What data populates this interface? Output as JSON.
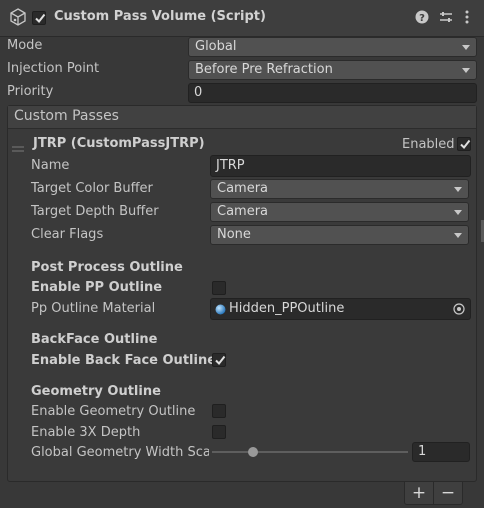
{
  "header": {
    "title": "Custom Pass Volume (Script)",
    "enabled": true
  },
  "fields": {
    "mode_label": "Mode",
    "mode_value": "Global",
    "injection_label": "Injection Point",
    "injection_value": "Before Pre Refraction",
    "priority_label": "Priority",
    "priority_value": "0"
  },
  "custom_passes": {
    "title": "Custom Passes",
    "pass": {
      "title": "JTRP (CustomPassJTRP)",
      "enabled_label": "Enabled",
      "enabled": true,
      "name_label": "Name",
      "name_value": "JTRP",
      "target_color_label": "Target Color Buffer",
      "target_color_value": "Camera",
      "target_depth_label": "Target Depth Buffer",
      "target_depth_value": "Camera",
      "clear_flags_label": "Clear Flags",
      "clear_flags_value": "None"
    },
    "post_process": {
      "header": "Post Process Outline",
      "enable_label": "Enable PP Outline",
      "enable_checked": false,
      "material_label": "Pp Outline Material",
      "material_value": "Hidden_PPOutline"
    },
    "backface": {
      "header": "BackFace Outline",
      "enable_label": "Enable Back Face Outline",
      "enable_checked": true
    },
    "geometry": {
      "header": "Geometry Outline",
      "enable_label": "Enable Geometry Outline",
      "enable_checked": false,
      "depth_label": "Enable 3X Depth",
      "depth_checked": false,
      "width_label": "Global Geometry Width Scal",
      "width_value": "1"
    }
  },
  "footer": {
    "add_label": "+",
    "remove_label": "−"
  },
  "icons": [
    "script-cube-icon",
    "help-icon",
    "preset-sliders-icon",
    "kebab-menu-icon",
    "checkmark-icon",
    "dropdown-arrow-icon",
    "object-picker-icon",
    "drag-handle-icon"
  ],
  "colors": {
    "background": "#383838",
    "field": "#2a2a2a",
    "dropdown": "#515151",
    "text": "#c4c4c4"
  }
}
